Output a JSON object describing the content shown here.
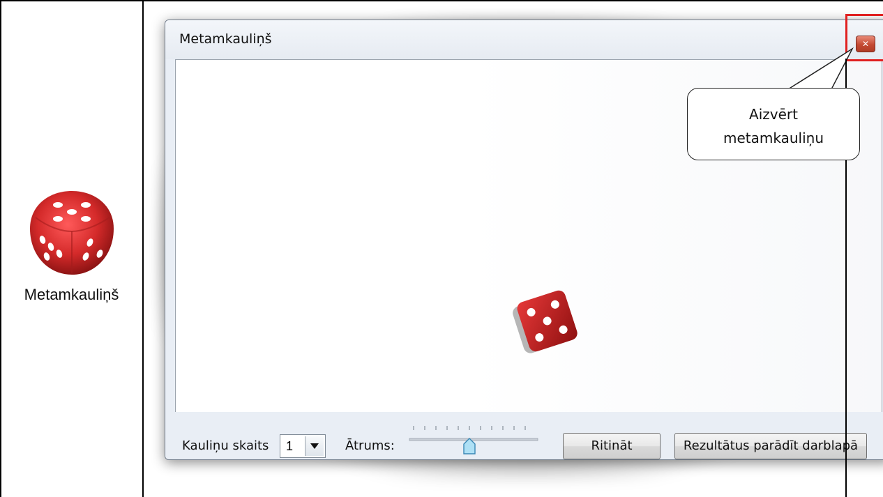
{
  "left_panel": {
    "app_label": "Metamkauliņš",
    "icon": "red-dice-icon"
  },
  "window": {
    "title": "Metamkauliņš",
    "close_icon": "close-icon",
    "dice_face_value": 5
  },
  "controls": {
    "dice_count_label": "Kauliņu skaits",
    "dice_count_value": "1",
    "speed_label": "Ātrums:",
    "speed_level_fraction": 0.5,
    "roll_button": "Ritināt",
    "show_results_button": "Rezultātus parādīt darblapā"
  },
  "annotation": {
    "line1": "Aizvērt",
    "line2": "metamkauliņu",
    "highlight_color": "#e02020"
  },
  "colors": {
    "dice_red": "#d42a2a",
    "window_bg": "#e9eef5"
  }
}
